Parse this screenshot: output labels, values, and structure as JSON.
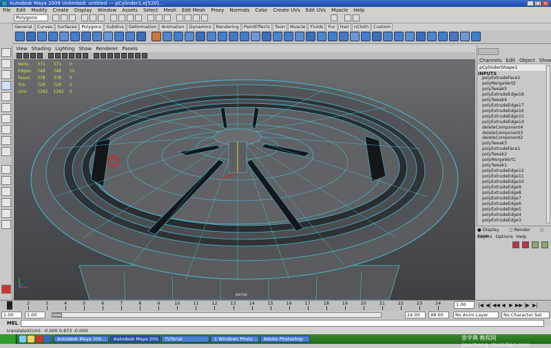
{
  "window": {
    "title": "Autodesk Maya 2009 Unlimited: untitled   ---   pCylinder1.e[520]..."
  },
  "menubar": [
    "File",
    "Edit",
    "Modify",
    "Create",
    "Display",
    "Window",
    "Assets",
    "Select",
    "Mesh",
    "Edit Mesh",
    "Proxy",
    "Normals",
    "Color",
    "Create UVs",
    "Edit UVs",
    "Muscle",
    "Help"
  ],
  "statusline": {
    "mode": "Polygons"
  },
  "shelf": {
    "tabs": [
      "General",
      "Curves",
      "Surfaces",
      "Polygons",
      "Subdivs",
      "Deformation",
      "Animation",
      "Dynamics",
      "Rendering",
      "PaintEffects",
      "Toon",
      "Muscle",
      "Fluids",
      "Fur",
      "Hair",
      "nCloth",
      "Custom"
    ],
    "active": "Polygons"
  },
  "viewport": {
    "menu": [
      "View",
      "Shading",
      "Lighting",
      "Show",
      "Renderer",
      "Panels"
    ],
    "hud": [
      {
        "label": "Verts:",
        "v1": "371",
        "v2": "371",
        "v3": "0"
      },
      {
        "label": "Edges:",
        "v1": "748",
        "v2": "748",
        "v3": "15"
      },
      {
        "label": "Faces:",
        "v1": "378",
        "v2": "378",
        "v3": "0"
      },
      {
        "label": "Tris:",
        "v1": "728",
        "v2": "728",
        "v3": "0"
      },
      {
        "label": "UVs:",
        "v1": "1262",
        "v2": "1262",
        "v3": "0"
      }
    ],
    "camera": "persp",
    "colors": {
      "mesh": "#5a5c60",
      "wire": "#48c0d8",
      "highlight": "#e02020"
    }
  },
  "channelbox": {
    "menu": [
      "Channels",
      "Edit",
      "Object",
      "Show"
    ],
    "object": "pCylinderShape1",
    "inputs_label": "INPUTS",
    "history": [
      "polyExtrudeFace2",
      "polyMergeVert2",
      "polyTweak5",
      "polyExtrudeEdge18",
      "polyTweak4",
      "polyExtrudeEdge17",
      "polyExtrudeEdge16",
      "polyExtrudeEdge15",
      "polyExtrudeEdge14",
      "deleteComponent4",
      "deleteComponent3",
      "deleteComponent2",
      "polyTweak3",
      "polyExtrudeFace1",
      "polyTweak2",
      "polyMergeVert1",
      "polyTweak1",
      "polyExtrudeEdge12",
      "polyExtrudeEdge11",
      "polyExtrudeEdge10",
      "polyExtrudeEdge9",
      "polyExtrudeEdge8",
      "polyExtrudeEdge7",
      "polyExtrudeEdge6",
      "polyExtrudeEdge5",
      "polyExtrudeEdge4",
      "polyExtrudeEdge3"
    ]
  },
  "layers": {
    "tabs": [
      "Display",
      "Render",
      "Anim"
    ],
    "active": "Display",
    "menu": [
      "Layers",
      "Options",
      "Help"
    ]
  },
  "timeline": {
    "ticks": [
      "1",
      "2",
      "3",
      "4",
      "5",
      "6",
      "7",
      "8",
      "9",
      "10",
      "11",
      "12",
      "13",
      "14",
      "15",
      "16",
      "17",
      "18",
      "19",
      "20",
      "21",
      "22",
      "23",
      "24"
    ],
    "current": "1.00"
  },
  "range": {
    "start": "1.00",
    "inner_start": "1.00",
    "inner_end": "24.00",
    "end": "48.00",
    "anim_layer": "No Anim Layer",
    "char_set": "No Character Set"
  },
  "mel": {
    "label": "MEL"
  },
  "helpline": {
    "text": "translateX(cm):  -0.000      0.873     -0.000"
  },
  "taskbar": {
    "tasks": [
      "Autodesk Maya 200...",
      "Autodesk Maya 200...",
      "TUTorial",
      "1 Windows Photo ...",
      "Adobe Photoshop"
    ],
    "watermark": "查字典 教程网  jiaocheng.chazidian.com"
  }
}
